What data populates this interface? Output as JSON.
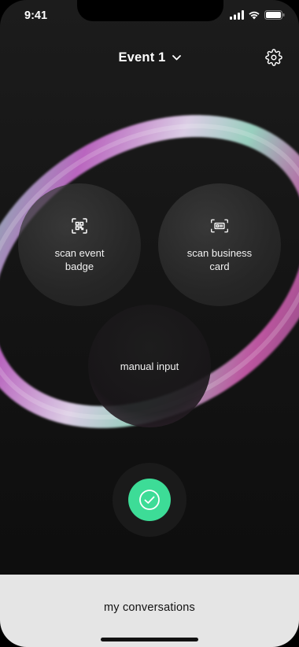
{
  "status_bar": {
    "time": "9:41",
    "icons": [
      "signal-icon",
      "wifi-icon",
      "battery-icon"
    ]
  },
  "header": {
    "event_title": "Event 1",
    "dropdown_icon": "chevron-down-icon",
    "settings_icon": "gear-icon"
  },
  "actions": [
    {
      "label": "scan event\nbadge",
      "icon": "qr-scan-icon"
    },
    {
      "label": "scan business\ncard",
      "icon": "card-scan-icon"
    },
    {
      "label": "manual input"
    }
  ],
  "confirm": {
    "icon": "check-circle-icon",
    "color": "#3ddc97"
  },
  "bottom_sheet": {
    "label": "my conversations"
  },
  "colors": {
    "background": "#141414",
    "accent_green": "#3ddc97",
    "ring_pink": "#c26ac8",
    "ring_mint": "#8de3c2",
    "sheet_bg": "#e5e5e5"
  }
}
